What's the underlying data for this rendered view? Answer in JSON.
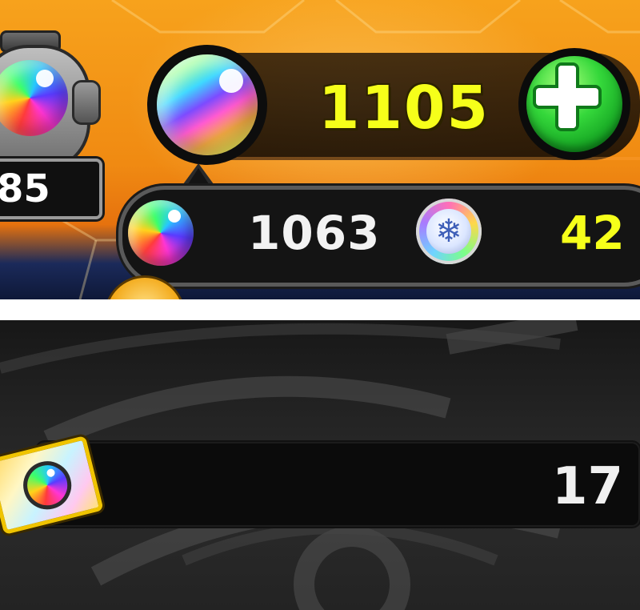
{
  "stamina": {
    "value": "85",
    "icon": "stamina-orb-icon"
  },
  "orbs": {
    "total": "1105",
    "paid": "1063",
    "free": "42",
    "add_icon": "plus-icon",
    "free_icon": "snowflake-icon"
  },
  "tickets": {
    "count": "17",
    "icon": "orb-ticket-icon"
  },
  "colors": {
    "accent_orange": "#f08a12",
    "count_yellow": "#f6ff1a",
    "add_green": "#35d83b",
    "dark_bar": "#141414"
  }
}
